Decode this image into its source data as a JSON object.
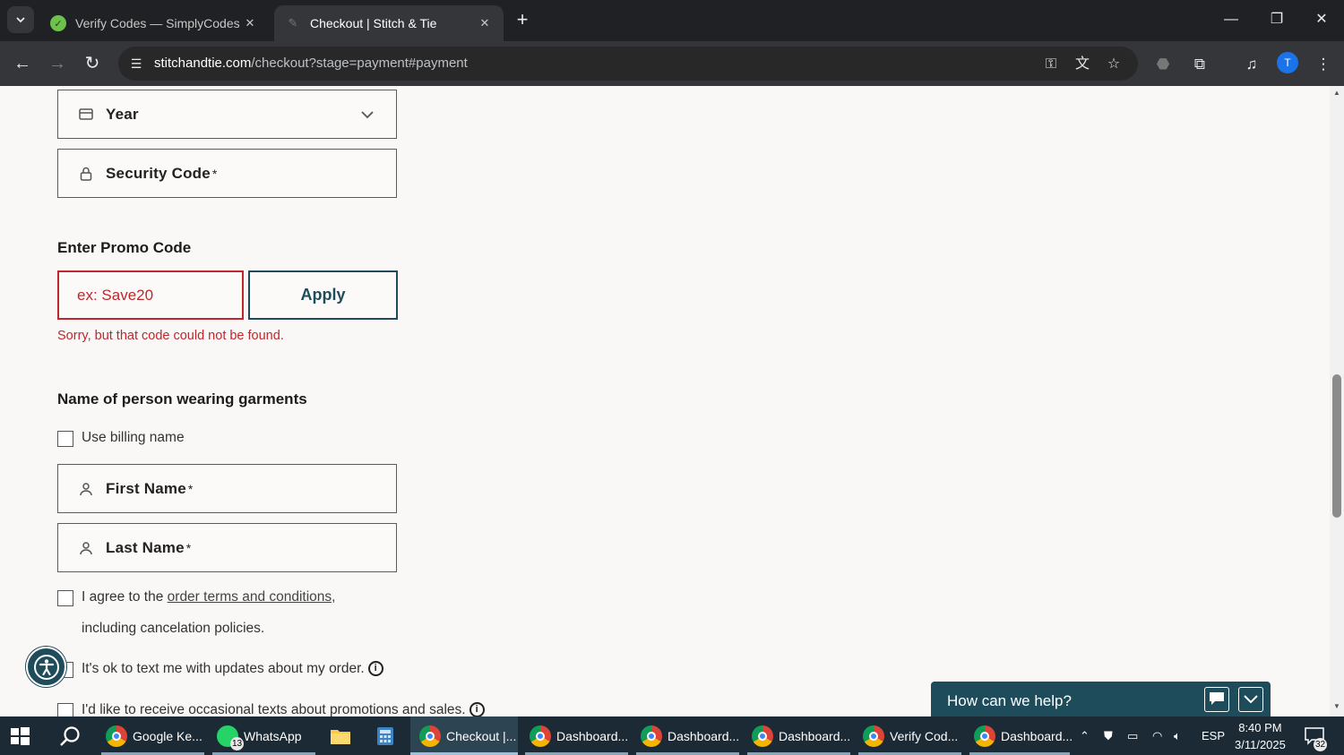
{
  "browser": {
    "tabs": [
      {
        "title": "Verify Codes — SimplyCodes",
        "active": false
      },
      {
        "title": "Checkout | Stitch & Tie",
        "active": true
      }
    ],
    "url_domain": "stitchandtie.com",
    "url_path": "/checkout?stage=payment#payment",
    "profile_initial": "T"
  },
  "form": {
    "year_label": "Year",
    "security_code_label": "Security Code",
    "required_mark": "*",
    "promo_heading": "Enter Promo Code",
    "promo_value": "ex: Save20",
    "apply_label": "Apply",
    "promo_error": "Sorry, but that code could not be found.",
    "wearer_heading": "Name of person wearing garments",
    "use_billing_label": "Use billing name",
    "first_name_label": "First Name",
    "last_name_label": "Last Name",
    "terms_prefix": "I agree to the ",
    "terms_link": "order terms and conditions,",
    "terms_suffix": "including cancelation policies.",
    "text_updates_label": "It's ok to text me with updates about my order.",
    "promo_texts_label": "I'd like to receive occasional texts about promotions and sales."
  },
  "chat": {
    "prompt": "How can we help?"
  },
  "taskbar": {
    "items": [
      {
        "label": "Google Ke..."
      },
      {
        "label": "WhatsApp",
        "badge": "13"
      },
      {
        "label": "Checkout |...",
        "active": true
      },
      {
        "label": "Dashboard..."
      },
      {
        "label": "Dashboard..."
      },
      {
        "label": "Dashboard..."
      },
      {
        "label": "Verify Cod..."
      },
      {
        "label": "Dashboard..."
      }
    ],
    "language": "ESP",
    "time": "8:40 PM",
    "date": "3/11/2025",
    "notifications": "32"
  }
}
